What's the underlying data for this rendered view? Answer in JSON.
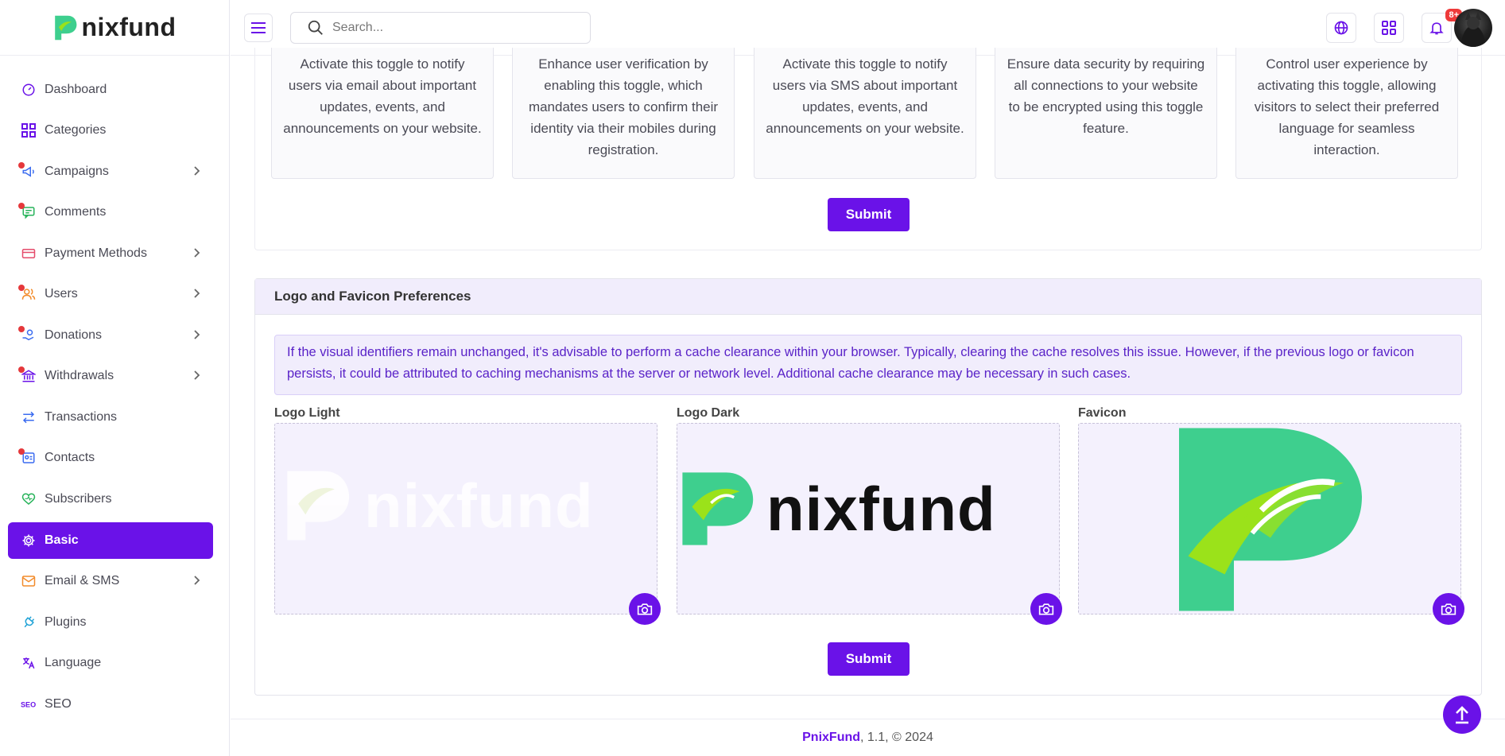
{
  "brand": {
    "name": "nixfund"
  },
  "sidebar": {
    "items": [
      {
        "label": "Dashboard",
        "icon": "dashboard-icon",
        "chevron": false,
        "dot": false,
        "color": "#6a12e8"
      },
      {
        "label": "Categories",
        "icon": "grid-icon",
        "chevron": false,
        "dot": false,
        "color": "#6a12e8"
      },
      {
        "label": "Campaigns",
        "icon": "megaphone-icon",
        "chevron": true,
        "dot": true,
        "color": "#3b6cf0"
      },
      {
        "label": "Comments",
        "icon": "comment-icon",
        "chevron": false,
        "dot": true,
        "color": "#27b35a"
      },
      {
        "label": "Payment Methods",
        "icon": "card-icon",
        "chevron": true,
        "dot": false,
        "color": "#e54b6b"
      },
      {
        "label": "Users",
        "icon": "users-icon",
        "chevron": true,
        "dot": true,
        "color": "#f28b2a"
      },
      {
        "label": "Donations",
        "icon": "donation-icon",
        "chevron": true,
        "dot": true,
        "color": "#3b6cf0"
      },
      {
        "label": "Withdrawals",
        "icon": "bank-icon",
        "chevron": true,
        "dot": true,
        "color": "#6a12e8"
      },
      {
        "label": "Transactions",
        "icon": "transfer-icon",
        "chevron": false,
        "dot": false,
        "color": "#3b6cf0"
      },
      {
        "label": "Contacts",
        "icon": "contact-icon",
        "chevron": false,
        "dot": true,
        "color": "#3b6cf0"
      },
      {
        "label": "Subscribers",
        "icon": "heart-icon",
        "chevron": false,
        "dot": false,
        "color": "#27b35a"
      },
      {
        "label": "Basic",
        "icon": "gear-icon",
        "chevron": false,
        "dot": false,
        "active": true,
        "color": "#ffffff"
      },
      {
        "label": "Email & SMS",
        "icon": "mail-icon",
        "chevron": true,
        "dot": false,
        "color": "#f28b2a"
      },
      {
        "label": "Plugins",
        "icon": "plug-icon",
        "chevron": false,
        "dot": false,
        "color": "#1fa2d6"
      },
      {
        "label": "Language",
        "icon": "translate-icon",
        "chevron": false,
        "dot": false,
        "color": "#6a12e8"
      },
      {
        "label": "SEO",
        "icon": "seo-icon",
        "chevron": false,
        "dot": false,
        "color": "#6a12e8"
      }
    ]
  },
  "topbar": {
    "search_placeholder": "Search...",
    "notification_badge": "8+"
  },
  "features": [
    {
      "text": "Activate this toggle to notify users via email about important updates, events, and announcements on your website."
    },
    {
      "text": "Enhance user verification by enabling this toggle, which mandates users to confirm their identity via their mobiles during registration."
    },
    {
      "text": "Activate this toggle to notify users via SMS about important updates, events, and announcements on your website."
    },
    {
      "text": "Ensure data security by requiring all connections to your website to be encrypted using this toggle feature."
    },
    {
      "text": "Control user experience by activating this toggle, allowing visitors to select their preferred language for seamless interaction."
    }
  ],
  "submit_label": "Submit",
  "logo_section": {
    "title": "Logo and Favicon Preferences",
    "alert": "If the visual identifiers remain unchanged, it's advisable to perform a cache clearance within your browser. Typically, clearing the cache resolves this issue. However, if the previous logo or favicon persists, it could be attributed to caching mechanisms at the server or network level. Additional cache clearance may be necessary in such cases.",
    "labels": {
      "light": "Logo Light",
      "dark": "Logo Dark",
      "favicon": "Favicon"
    },
    "light_wordmark": "nixfund",
    "dark_wordmark": "nixfund"
  },
  "footer": {
    "brand": "PnixFund",
    "rest": ", 1.1, © 2024"
  },
  "colors": {
    "accent": "#6a12e8",
    "brand_green": "#3ecf8e",
    "brand_lime": "#9be21a"
  }
}
